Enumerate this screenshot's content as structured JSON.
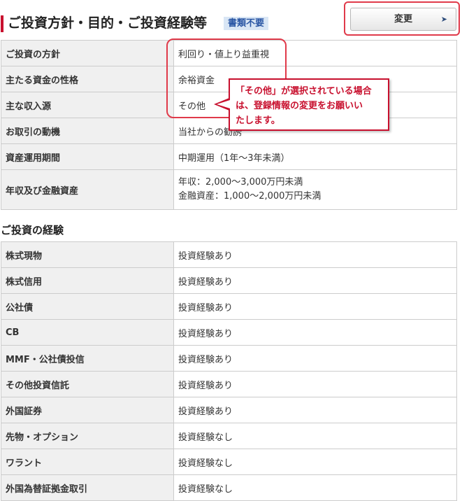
{
  "header": {
    "title": "ご投資方針・目的・ご投資経験等",
    "badge": "書類不要",
    "change_button": "変更",
    "change_arrow": "➤"
  },
  "profile_rows": [
    {
      "label": "ご投資の方針",
      "value": "利回り・値上り益重視"
    },
    {
      "label": "主たる資金の性格",
      "value": "余裕資金"
    },
    {
      "label": "主な収入源",
      "value": "その他"
    },
    {
      "label": "お取引の動機",
      "value": "当社からの勧誘"
    },
    {
      "label": "資産運用期間",
      "value": "中期運用（1年～3年未満）"
    },
    {
      "label": "年収及び金融資産",
      "value_lines": [
        "年収：2,000～3,000万円未満",
        "金融資産：1,000～2,000万円未満"
      ]
    }
  ],
  "experience": {
    "title": "ご投資の経験",
    "rows": [
      {
        "label": "株式現物",
        "value": "投資経験あり"
      },
      {
        "label": "株式信用",
        "value": "投資経験あり"
      },
      {
        "label": "公社債",
        "value": "投資経験あり"
      },
      {
        "label": "CB",
        "value": "投資経験あり"
      },
      {
        "label": "MMF・公社債投信",
        "value": "投資経験あり"
      },
      {
        "label": "その他投資信託",
        "value": "投資経験あり"
      },
      {
        "label": "外国証券",
        "value": "投資経験あり"
      },
      {
        "label": "先物・オプション",
        "value": "投資経験なし"
      },
      {
        "label": "ワラント",
        "value": "投資経験なし"
      },
      {
        "label": "外国為替証拠金取引",
        "value": "投資経験なし"
      }
    ]
  },
  "callout": {
    "lines": [
      "「その他」が選択されている場合",
      "は、登録情報の変更をお願いい",
      "たします。"
    ]
  },
  "colors": {
    "accent": "#c8102e",
    "badge_bg": "#d9e6f5",
    "badge_text": "#2a56a4",
    "header_cell_bg": "#f0f0f0"
  }
}
